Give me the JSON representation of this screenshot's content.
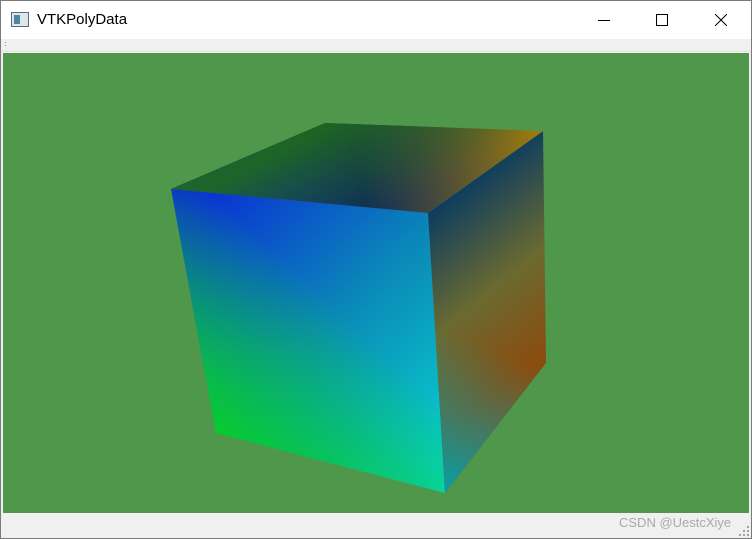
{
  "window": {
    "title": "VTKPolyData"
  },
  "controls": {
    "minimize_icon": "minimize-icon",
    "maximize_icon": "maximize-icon",
    "close_icon": "close-icon"
  },
  "viewport": {
    "background_color": "#4e974b",
    "object": "cube",
    "vertex_colors": {
      "top_back_left": "#1f6b1b",
      "top_back_right": "#a07d0b",
      "top_front_left": "#0a24d8",
      "top_front_right": "#0c3c60",
      "bottom_front_left": "#08cc2c",
      "bottom_front_right": "#08d8d0",
      "bottom_back_right": "#8a4d10"
    }
  },
  "watermark": {
    "text": "CSDN @UestcXiye"
  }
}
